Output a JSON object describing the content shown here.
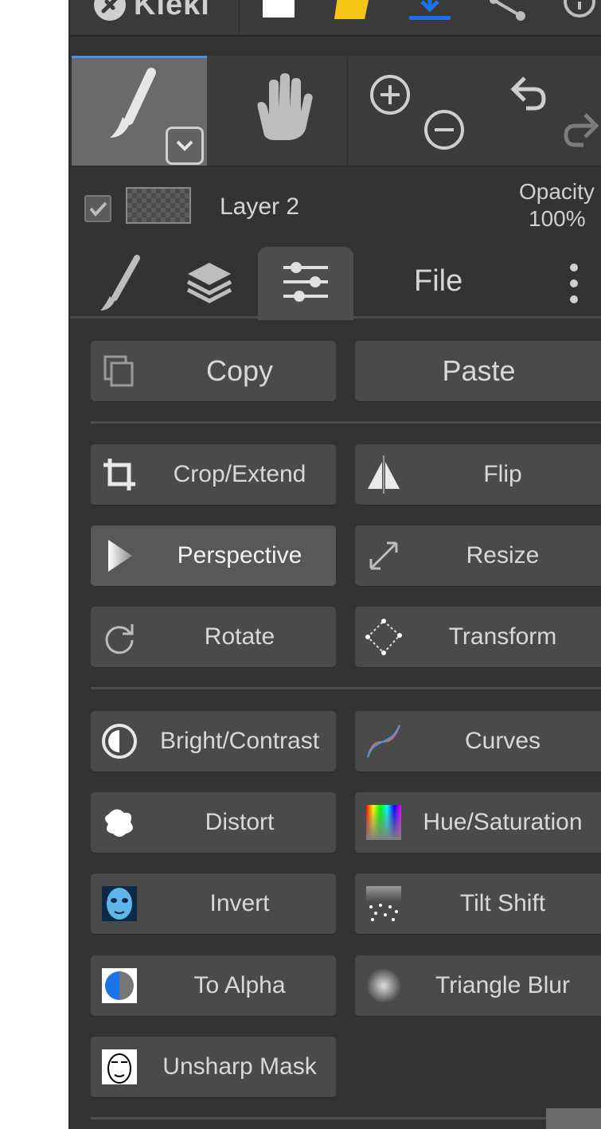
{
  "app": {
    "title": "Kleki"
  },
  "topbar": {
    "icons": [
      "kleki-logo-icon",
      "new-image-icon",
      "open-folder-icon",
      "download-icon",
      "share-icon",
      "help-icon"
    ],
    "colors": {
      "folder": "#f5c518",
      "download": "#1a73e8"
    }
  },
  "tools": {
    "brush": "brush-tool",
    "hand": "hand-tool",
    "zoom_in": "zoom-in",
    "zoom_out": "zoom-out",
    "undo": "undo",
    "redo": "redo",
    "active_color": "#4a90e2"
  },
  "layer": {
    "name": "Layer 2",
    "visible": true,
    "opacity_label": "Opacity",
    "opacity_value": "100%"
  },
  "tabs": {
    "items": [
      "brush-tab",
      "layers-tab",
      "edit-tab",
      "file-tab",
      "more-tab"
    ],
    "file_label": "File",
    "active": "edit-tab"
  },
  "edit": {
    "copy": "Copy",
    "paste": "Paste",
    "crop": "Crop/Extend",
    "flip": "Flip",
    "perspective": "Perspective",
    "resize": "Resize",
    "rotate": "Rotate",
    "transform": "Transform",
    "bright_contrast": "Bright/Contrast",
    "curves": "Curves",
    "distort": "Distort",
    "hue_saturation": "Hue/Saturation",
    "invert": "Invert",
    "tilt_shift": "Tilt Shift",
    "to_alpha": "To Alpha",
    "triangle_blur": "Triangle Blur",
    "unsharp_mask": "Unsharp Mask"
  }
}
